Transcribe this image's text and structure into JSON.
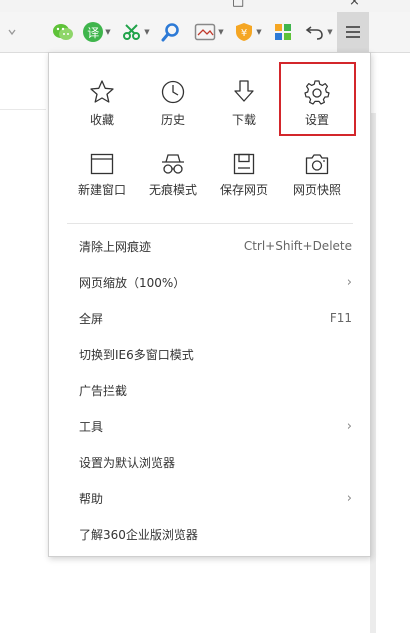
{
  "toolbar": {
    "icons": [
      "chevron-down-icon",
      "wechat-icon",
      "translate-icon",
      "scissors-icon",
      "search-icon",
      "screenshot-icon",
      "coupon-icon",
      "apps-icon",
      "undo-icon",
      "menu-icon"
    ],
    "translate_glyph": "译"
  },
  "menu": {
    "tiles_row1": [
      {
        "label": "收藏",
        "icon": "star-icon"
      },
      {
        "label": "历史",
        "icon": "clock-icon"
      },
      {
        "label": "下载",
        "icon": "download-icon"
      },
      {
        "label": "设置",
        "icon": "gear-icon"
      }
    ],
    "tiles_row2": [
      {
        "label": "新建窗口",
        "icon": "new-window-icon"
      },
      {
        "label": "无痕模式",
        "icon": "incognito-icon"
      },
      {
        "label": "保存网页",
        "icon": "save-page-icon"
      },
      {
        "label": "网页快照",
        "icon": "camera-icon"
      }
    ],
    "items": [
      {
        "label": "清除上网痕迹",
        "shortcut": "Ctrl+Shift+Delete"
      },
      {
        "label": "网页缩放（100%）",
        "submenu": "›"
      },
      {
        "label": "全屏",
        "shortcut": "F11"
      },
      {
        "label": "切换到IE6多窗口模式"
      },
      {
        "label": "广告拦截"
      },
      {
        "label": "工具",
        "submenu": "›"
      },
      {
        "label": "设置为默认浏览器"
      },
      {
        "label": "帮助",
        "submenu": "›"
      },
      {
        "label": "了解360企业版浏览器"
      }
    ]
  },
  "colors": {
    "highlight_border": "#d3262b",
    "wechat_green": "#5ec238",
    "translate_green": "#3fb54c",
    "scissors_green": "#21a34a",
    "search_blue": "#2d7ad6",
    "coupon_orange": "#f5a623"
  }
}
